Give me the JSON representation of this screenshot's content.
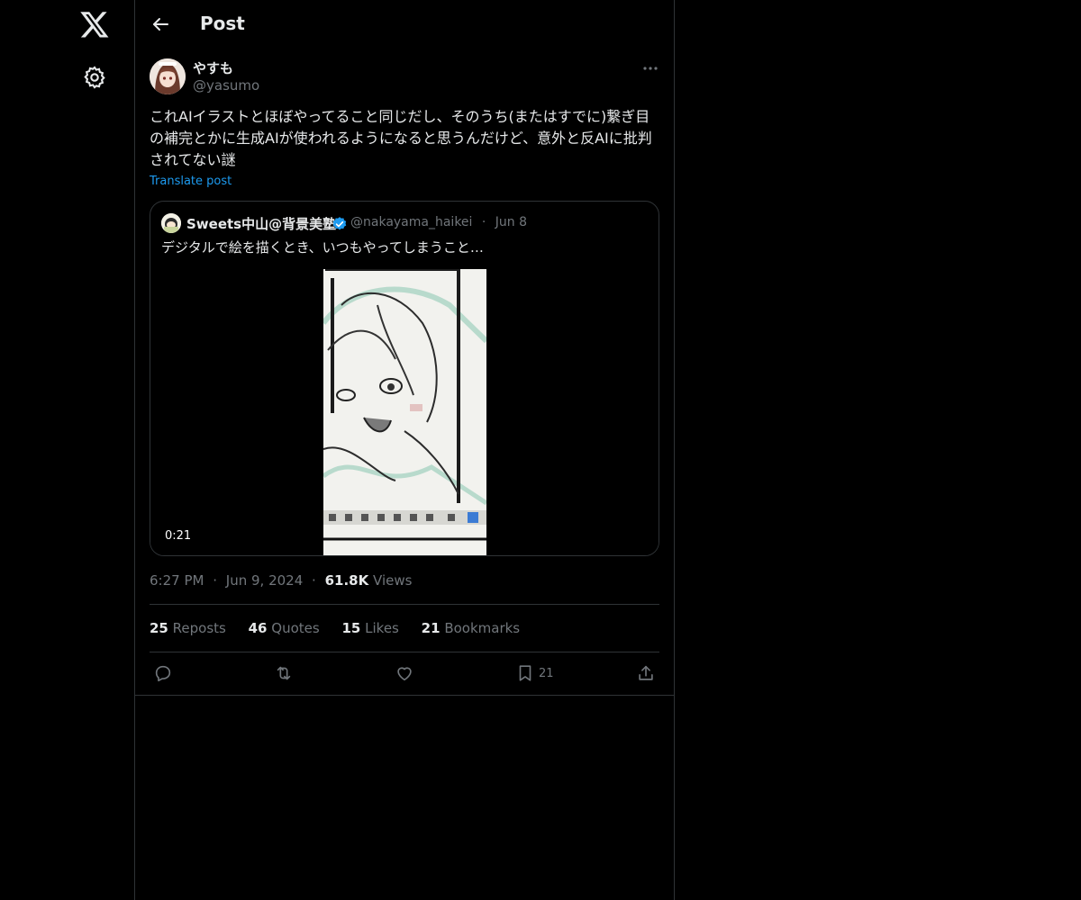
{
  "header": {
    "title": "Post"
  },
  "author": {
    "name": "やすも",
    "handle": "@yasumo"
  },
  "post": {
    "text": "これAIイラストとほぼやってること同じだし、そのうち(またはすでに)繋ぎ目の補完とかに生成AIが使われるようになると思うんだけど、意外と反AIに批判されてない謎",
    "translate_label": "Translate post",
    "time": "6:27 PM",
    "date": "Jun 9, 2024",
    "views_count": "61.8K",
    "views_label": "Views"
  },
  "quoted": {
    "name": "Sweets中山@背景美塾",
    "handle": "@nakayama_haikei",
    "date": "Jun 8",
    "text": "デジタルで絵を描くとき、いつもやってしまうこと…",
    "video_duration": "0:21"
  },
  "stats": {
    "reposts_count": "25",
    "reposts_label": "Reposts",
    "quotes_count": "46",
    "quotes_label": "Quotes",
    "likes_count": "15",
    "likes_label": "Likes",
    "bookmarks_count": "21",
    "bookmarks_label": "Bookmarks"
  },
  "actions": {
    "bookmark_count": "21"
  },
  "separators": {
    "dot": "·"
  },
  "colors": {
    "background": "#000000",
    "accent": "#1d9bf0",
    "muted": "#71767b",
    "border": "#2f3336",
    "verified": "#1d9bf0"
  },
  "icons": [
    "x-logo-icon",
    "settings-gear-icon",
    "back-arrow-icon",
    "more-icon",
    "verified-badge-icon",
    "reply-icon",
    "repost-icon",
    "like-icon",
    "bookmark-icon",
    "share-icon"
  ]
}
